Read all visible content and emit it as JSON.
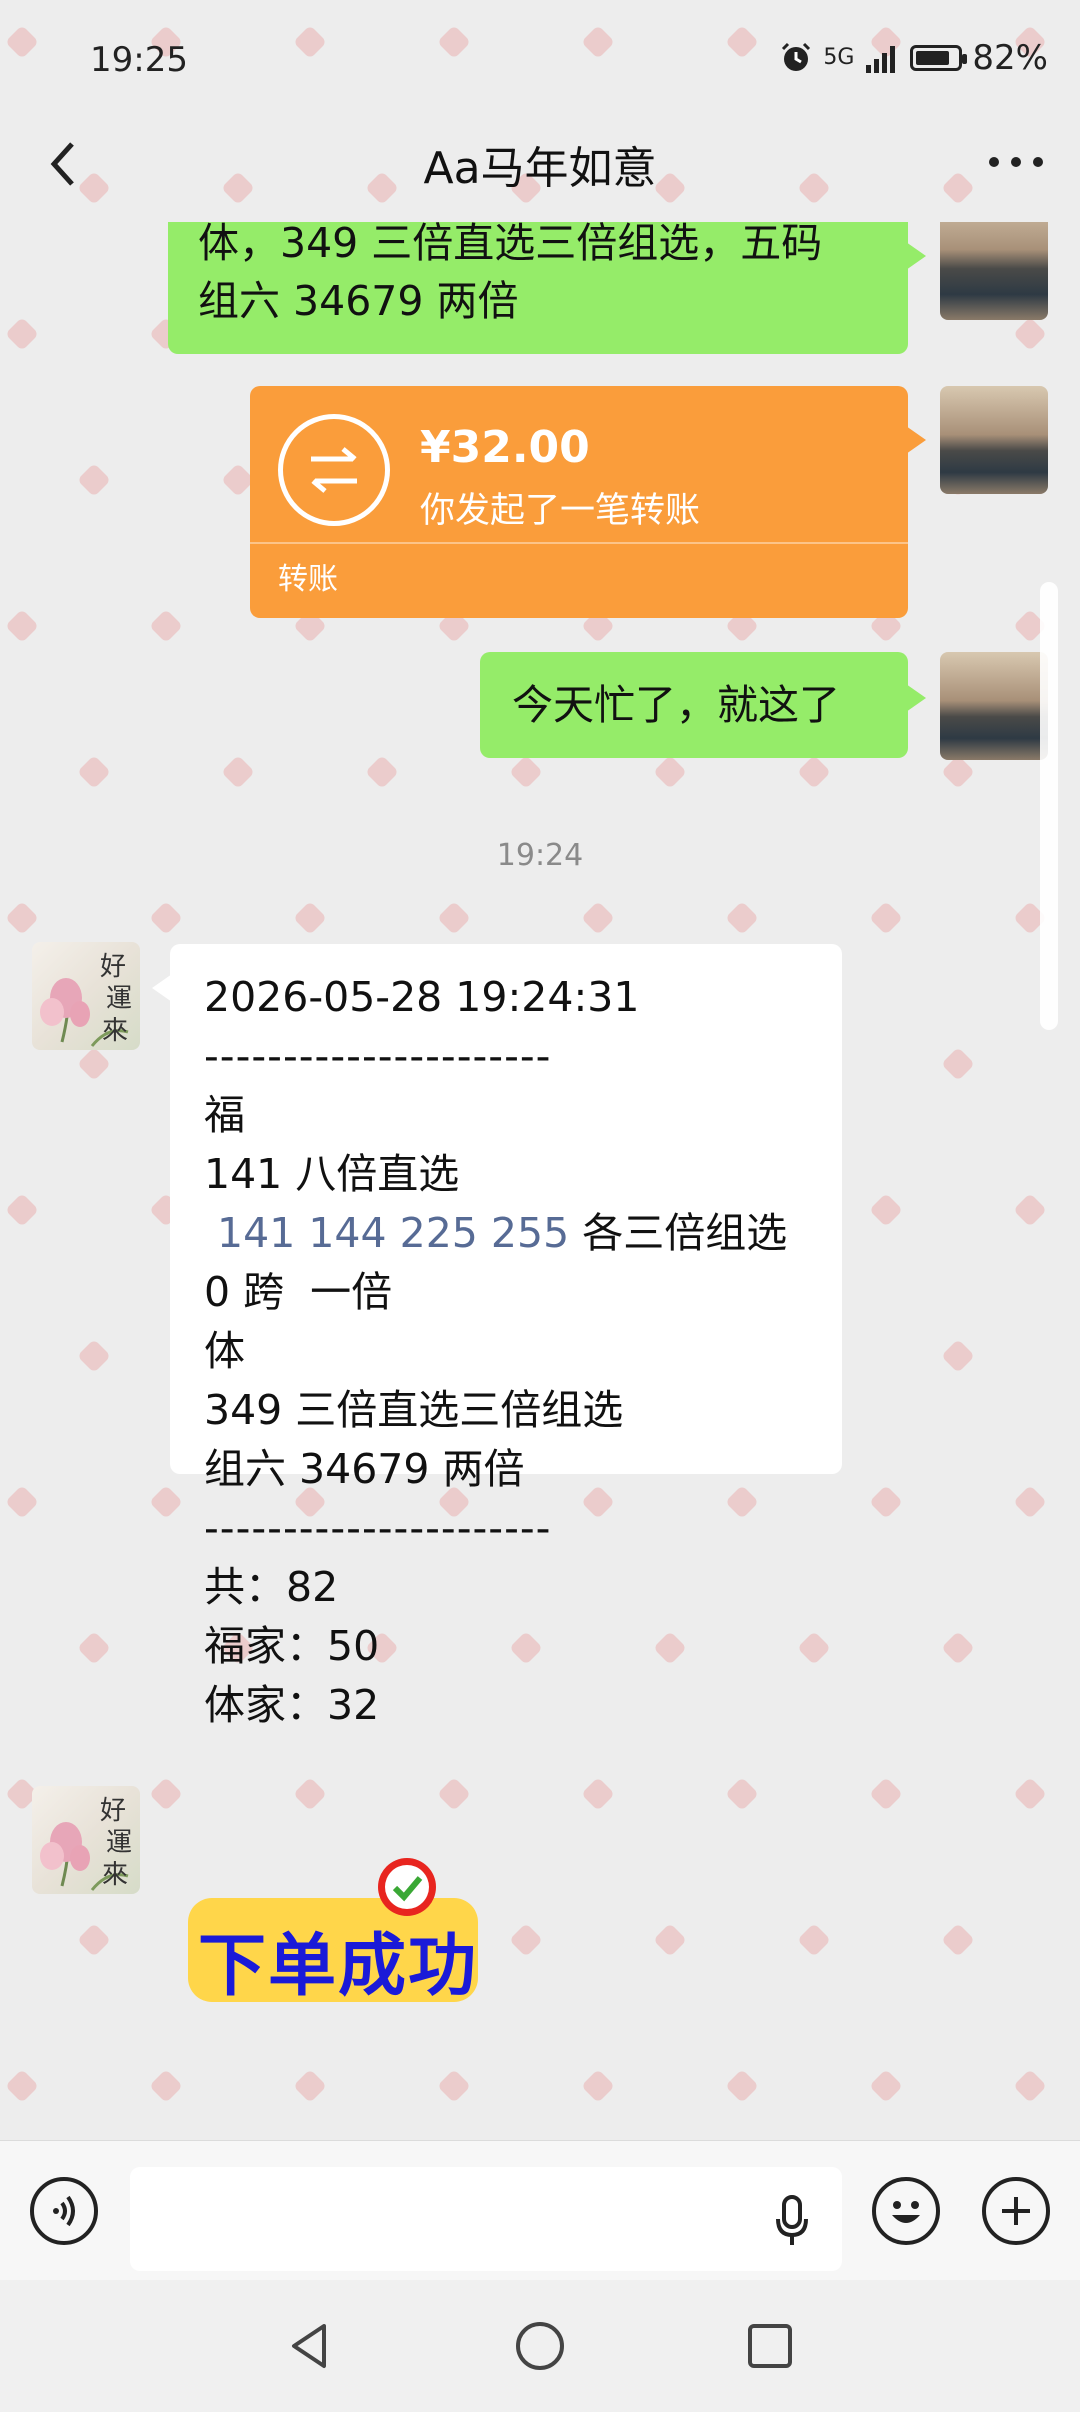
{
  "status_bar": {
    "time": "19:25",
    "network": "5G",
    "battery_percent": "82%",
    "battery_level": 0.82
  },
  "header": {
    "title": "Aa马年如意"
  },
  "messages": {
    "m1_lines": [
      "体，349 三倍直选三倍组选，五码",
      "组六 34679 两倍"
    ],
    "transfer": {
      "amount": "¥32.00",
      "description": "你发起了一笔转账",
      "label": "转账"
    },
    "m3_text": "今天忙了，就这了",
    "timestamp": "19:24",
    "order": {
      "datetime": "2026-05-28 19:24:31",
      "divider": "----------------------",
      "l1": "福",
      "l2": "141 八倍直选",
      "l3_numbers": " 141 144 225 255",
      "l3_suffix": " 各三倍组选",
      "l4": "0 跨  一倍",
      "l5": "体",
      "l6": "349 三倍直选三倍组选",
      "l7": "组六 34679 两倍",
      "total": "共：82",
      "fu_total": "福家：50",
      "ti_total": "体家：32"
    },
    "sticker_text": "下单成功"
  },
  "avatars": {
    "lotus_calligraphy": [
      "好",
      "運",
      "來"
    ]
  },
  "colors": {
    "chat_bg": "#ededed",
    "sent_bubble": "#95ec69",
    "transfer_bubble": "#fa9d3b",
    "link_blue": "#576b95",
    "sticker_text": "#1a1ad8",
    "sticker_bg": "#ffd64a"
  },
  "input": {
    "placeholder": ""
  },
  "icons": [
    "back-arrow-icon",
    "more-dots-icon",
    "alarm-icon",
    "signal-icon",
    "battery-icon",
    "transfer-arrows-icon",
    "voice-toggle-icon",
    "microphone-icon",
    "emoji-icon",
    "plus-icon",
    "nav-back-icon",
    "nav-home-icon",
    "nav-recents-icon"
  ]
}
